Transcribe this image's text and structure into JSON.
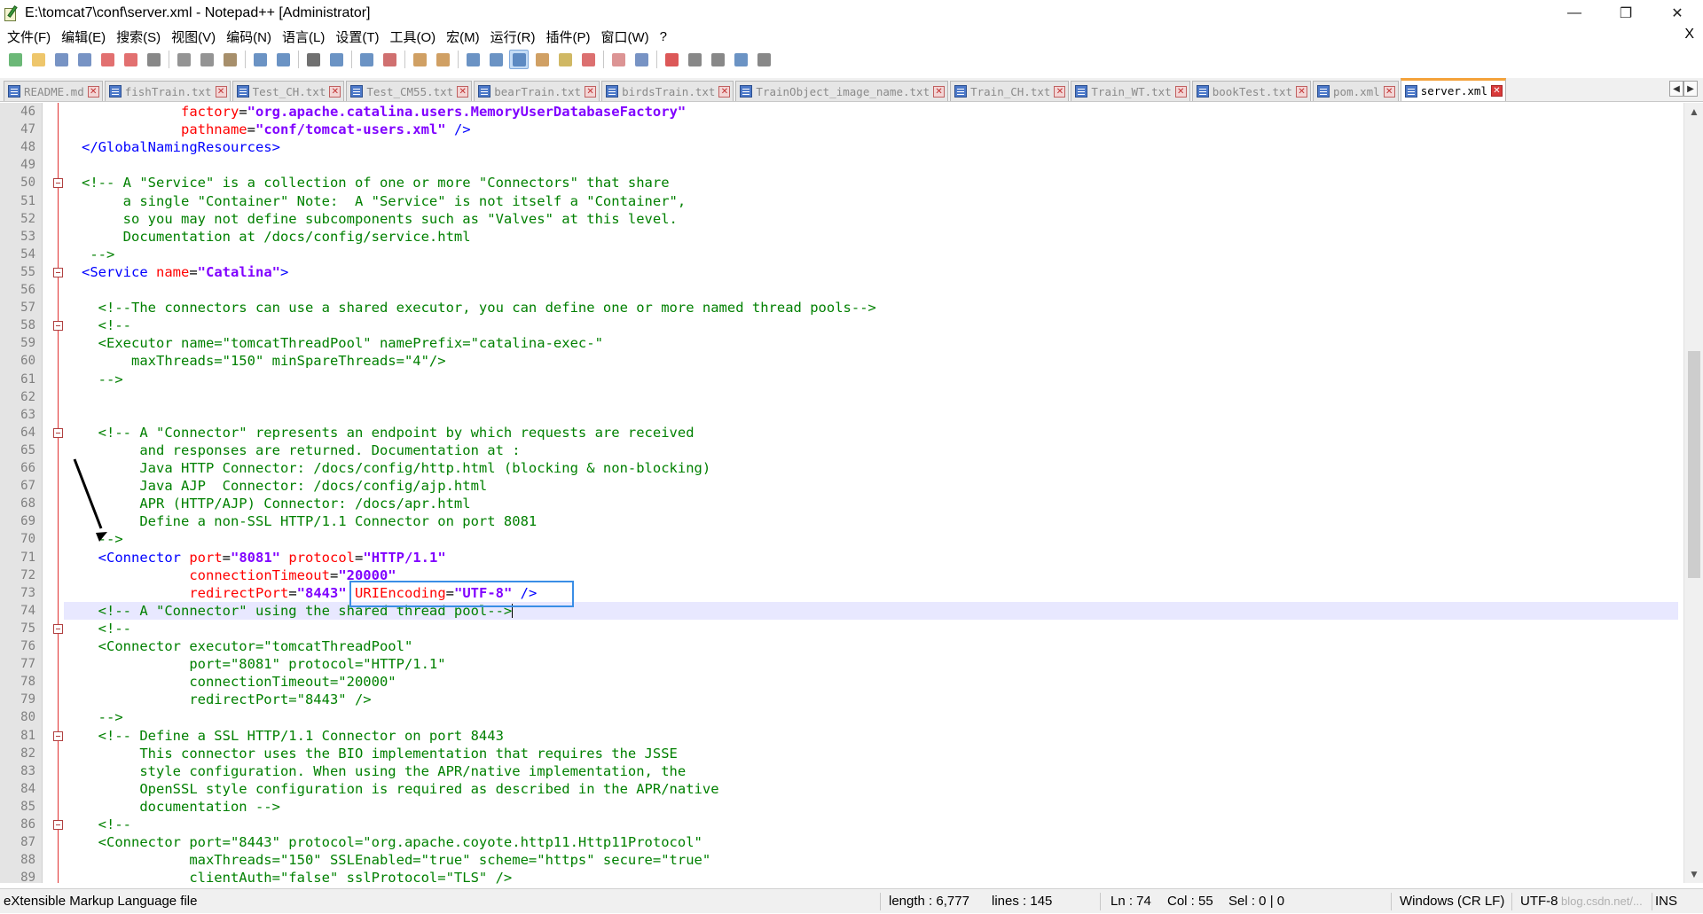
{
  "window": {
    "title": "E:\\tomcat7\\conf\\server.xml - Notepad++ [Administrator]",
    "minimize": "—",
    "maximize": "❐",
    "close": "✕"
  },
  "menu": {
    "items": [
      "文件(F)",
      "编辑(E)",
      "搜索(S)",
      "视图(V)",
      "编码(N)",
      "语言(L)",
      "设置(T)",
      "工具(O)",
      "宏(M)",
      "运行(R)",
      "插件(P)",
      "窗口(W)",
      "?"
    ],
    "close": "X"
  },
  "toolbar": {
    "icons": [
      "new-file-icon",
      "open-file-icon",
      "save-icon",
      "save-all-icon",
      "close-icon",
      "close-all-icon",
      "print-icon",
      "cut-icon",
      "copy-icon",
      "paste-icon",
      "undo-icon",
      "redo-icon",
      "find-icon",
      "replace-icon",
      "zoom-in-icon",
      "zoom-out-icon",
      "sync-vertical-icon",
      "sync-horizontal-icon",
      "word-wrap-icon",
      "show-all-chars-icon",
      "indent-guide-icon",
      "user-lang-icon",
      "doc-map-icon",
      "function-list-icon",
      "folder-workspace-icon",
      "monitor-icon",
      "record-macro-icon",
      "stop-macro-icon",
      "play-macro-icon",
      "run-macro-multiple-icon",
      "save-macro-icon"
    ],
    "icon_colors": [
      "#3aa04a",
      "#e8b33a",
      "#4a6fb0",
      "#4a6fb0",
      "#d84040",
      "#d84040",
      "#606060",
      "#707070",
      "#707070",
      "#8a6a3a",
      "#3a6fb0",
      "#3a6fb0",
      "#404040",
      "#3a6fb0",
      "#3a6fb0",
      "#c04040",
      "#c08030",
      "#c08030",
      "#3a6fb0",
      "#3a6fb0",
      "#3a6fb0",
      "#c08030",
      "#c0a030",
      "#d04040",
      "#d07070",
      "#4a6fb0",
      "#d02020",
      "#606060",
      "#606060",
      "#3a6fb0",
      "#606060"
    ]
  },
  "tabs": [
    {
      "label": "README.md"
    },
    {
      "label": "fishTrain.txt"
    },
    {
      "label": "Test_CH.txt"
    },
    {
      "label": "Test_CM55.txt"
    },
    {
      "label": "bearTrain.txt"
    },
    {
      "label": "birdsTrain.txt"
    },
    {
      "label": "TrainObject_image_name.txt"
    },
    {
      "label": "Train_CH.txt"
    },
    {
      "label": "Train_WT.txt"
    },
    {
      "label": "bookTest.txt"
    },
    {
      "label": "pom.xml"
    },
    {
      "label": "server.xml",
      "active": true
    }
  ],
  "tab_nav": {
    "left": "◀",
    "right": "▶"
  },
  "editor": {
    "current_line": 74,
    "lines": [
      {
        "n": "46",
        "tokens": [
          [
            "plain",
            "            "
          ],
          [
            "attr",
            "factory"
          ],
          [
            "plain",
            "="
          ],
          [
            "val",
            "\"org.apache.catalina.users.MemoryUserDatabaseFactory\""
          ]
        ]
      },
      {
        "n": "47",
        "tokens": [
          [
            "plain",
            "            "
          ],
          [
            "attr",
            "pathname"
          ],
          [
            "plain",
            "="
          ],
          [
            "val",
            "\"conf/tomcat-users.xml\""
          ],
          [
            "plain",
            " "
          ],
          [
            "tag",
            "/>"
          ]
        ]
      },
      {
        "n": "48",
        "tokens": [
          [
            "tag",
            "</GlobalNamingResources>"
          ]
        ]
      },
      {
        "n": "49",
        "tokens": []
      },
      {
        "n": "50",
        "fold": true,
        "tokens": [
          [
            "comment",
            "<!-- A \"Service\" is a collection of one or more \"Connectors\" that share"
          ]
        ]
      },
      {
        "n": "51",
        "tokens": [
          [
            "comment",
            "     a single \"Container\" Note:  A \"Service\" is not itself a \"Container\","
          ]
        ]
      },
      {
        "n": "52",
        "tokens": [
          [
            "comment",
            "     so you may not define subcomponents such as \"Valves\" at this level."
          ]
        ]
      },
      {
        "n": "53",
        "tokens": [
          [
            "comment",
            "     Documentation at /docs/config/service.html"
          ]
        ]
      },
      {
        "n": "54",
        "tokens": [
          [
            "comment",
            " -->"
          ]
        ]
      },
      {
        "n": "55",
        "fold": true,
        "tokens": [
          [
            "tag",
            "<Service"
          ],
          [
            "plain",
            " "
          ],
          [
            "attr",
            "name"
          ],
          [
            "plain",
            "="
          ],
          [
            "val",
            "\"Catalina\""
          ],
          [
            "tag",
            ">"
          ]
        ]
      },
      {
        "n": "56",
        "tokens": []
      },
      {
        "n": "57",
        "tokens": [
          [
            "comment",
            "  <!--The connectors can use a shared executor, you can define one or more named thread pools-->"
          ]
        ]
      },
      {
        "n": "58",
        "fold": true,
        "tokens": [
          [
            "comment",
            "  <!--"
          ]
        ]
      },
      {
        "n": "59",
        "tokens": [
          [
            "comment",
            "  <Executor name=\"tomcatThreadPool\" namePrefix=\"catalina-exec-\""
          ]
        ]
      },
      {
        "n": "60",
        "tokens": [
          [
            "comment",
            "      maxThreads=\"150\" minSpareThreads=\"4\"/>"
          ]
        ]
      },
      {
        "n": "61",
        "tokens": [
          [
            "comment",
            "  -->"
          ]
        ]
      },
      {
        "n": "62",
        "tokens": []
      },
      {
        "n": "63",
        "tokens": []
      },
      {
        "n": "64",
        "fold": true,
        "tokens": [
          [
            "comment",
            "  <!-- A \"Connector\" represents an endpoint by which requests are received"
          ]
        ]
      },
      {
        "n": "65",
        "tokens": [
          [
            "comment",
            "       and responses are returned. Documentation at :"
          ]
        ]
      },
      {
        "n": "66",
        "tokens": [
          [
            "comment",
            "       Java HTTP Connector: /docs/config/http.html (blocking & non-blocking)"
          ]
        ]
      },
      {
        "n": "67",
        "tokens": [
          [
            "comment",
            "       Java AJP  Connector: /docs/config/ajp.html"
          ]
        ]
      },
      {
        "n": "68",
        "tokens": [
          [
            "comment",
            "       APR (HTTP/AJP) Connector: /docs/apr.html"
          ]
        ]
      },
      {
        "n": "69",
        "tokens": [
          [
            "comment",
            "       Define a non-SSL HTTP/1.1 Connector on port 8081"
          ]
        ]
      },
      {
        "n": "70",
        "tokens": [
          [
            "comment",
            "  -->"
          ]
        ]
      },
      {
        "n": "71",
        "tokens": [
          [
            "plain",
            "  "
          ],
          [
            "tag",
            "<Connector"
          ],
          [
            "plain",
            " "
          ],
          [
            "attr",
            "port"
          ],
          [
            "plain",
            "="
          ],
          [
            "val",
            "\"8081\""
          ],
          [
            "plain",
            " "
          ],
          [
            "attr",
            "protocol"
          ],
          [
            "plain",
            "="
          ],
          [
            "val",
            "\"HTTP/1.1\""
          ]
        ]
      },
      {
        "n": "72",
        "tokens": [
          [
            "plain",
            "             "
          ],
          [
            "attr",
            "connectionTimeout"
          ],
          [
            "plain",
            "="
          ],
          [
            "val",
            "\"20000\""
          ]
        ]
      },
      {
        "n": "73",
        "tokens": [
          [
            "plain",
            "             "
          ],
          [
            "attr",
            "redirectPort"
          ],
          [
            "plain",
            "="
          ],
          [
            "val",
            "\"8443\""
          ],
          [
            "plain",
            " "
          ],
          [
            "attr",
            "URIEncoding"
          ],
          [
            "plain",
            "="
          ],
          [
            "val",
            "\"UTF-8\""
          ],
          [
            "plain",
            " "
          ],
          [
            "tag",
            "/>"
          ]
        ]
      },
      {
        "n": "74",
        "tokens": [
          [
            "comment",
            "  <!-- A \"Connector\" using the shared thread pool-->"
          ]
        ]
      },
      {
        "n": "75",
        "fold": true,
        "tokens": [
          [
            "comment",
            "  <!--"
          ]
        ]
      },
      {
        "n": "76",
        "tokens": [
          [
            "comment",
            "  <Connector executor=\"tomcatThreadPool\""
          ]
        ]
      },
      {
        "n": "77",
        "tokens": [
          [
            "comment",
            "             port=\"8081\" protocol=\"HTTP/1.1\""
          ]
        ]
      },
      {
        "n": "78",
        "tokens": [
          [
            "comment",
            "             connectionTimeout=\"20000\""
          ]
        ]
      },
      {
        "n": "79",
        "tokens": [
          [
            "comment",
            "             redirectPort=\"8443\" />"
          ]
        ]
      },
      {
        "n": "80",
        "tokens": [
          [
            "comment",
            "  -->"
          ]
        ]
      },
      {
        "n": "81",
        "fold": true,
        "tokens": [
          [
            "comment",
            "  <!-- Define a SSL HTTP/1.1 Connector on port 8443"
          ]
        ]
      },
      {
        "n": "82",
        "tokens": [
          [
            "comment",
            "       This connector uses the BIO implementation that requires the JSSE"
          ]
        ]
      },
      {
        "n": "83",
        "tokens": [
          [
            "comment",
            "       style configuration. When using the APR/native implementation, the"
          ]
        ]
      },
      {
        "n": "84",
        "tokens": [
          [
            "comment",
            "       OpenSSL style configuration is required as described in the APR/native"
          ]
        ]
      },
      {
        "n": "85",
        "tokens": [
          [
            "comment",
            "       documentation -->"
          ]
        ]
      },
      {
        "n": "86",
        "fold": true,
        "tokens": [
          [
            "comment",
            "  <!--"
          ]
        ]
      },
      {
        "n": "87",
        "tokens": [
          [
            "comment",
            "  <Connector port=\"8443\" protocol=\"org.apache.coyote.http11.Http11Protocol\""
          ]
        ]
      },
      {
        "n": "88",
        "tokens": [
          [
            "comment",
            "             maxThreads=\"150\" SSLEnabled=\"true\" scheme=\"https\" secure=\"true\""
          ]
        ]
      },
      {
        "n": "89",
        "tokens": [
          [
            "comment",
            "             clientAuth=\"false\" sslProtocol=\"TLS\" />"
          ]
        ]
      }
    ]
  },
  "scrollbar": {
    "up": "▲",
    "down": "▼"
  },
  "status": {
    "file_type": "eXtensible Markup Language file",
    "length": "length : 6,777",
    "lines": "lines : 145",
    "ln": "Ln : 74",
    "col": "Col : 55",
    "sel": "Sel : 0 | 0",
    "eol": "Windows (CR LF)",
    "encoding": "UTF-8",
    "mode": "INS",
    "watermark": "blog.csdn.net/..."
  }
}
